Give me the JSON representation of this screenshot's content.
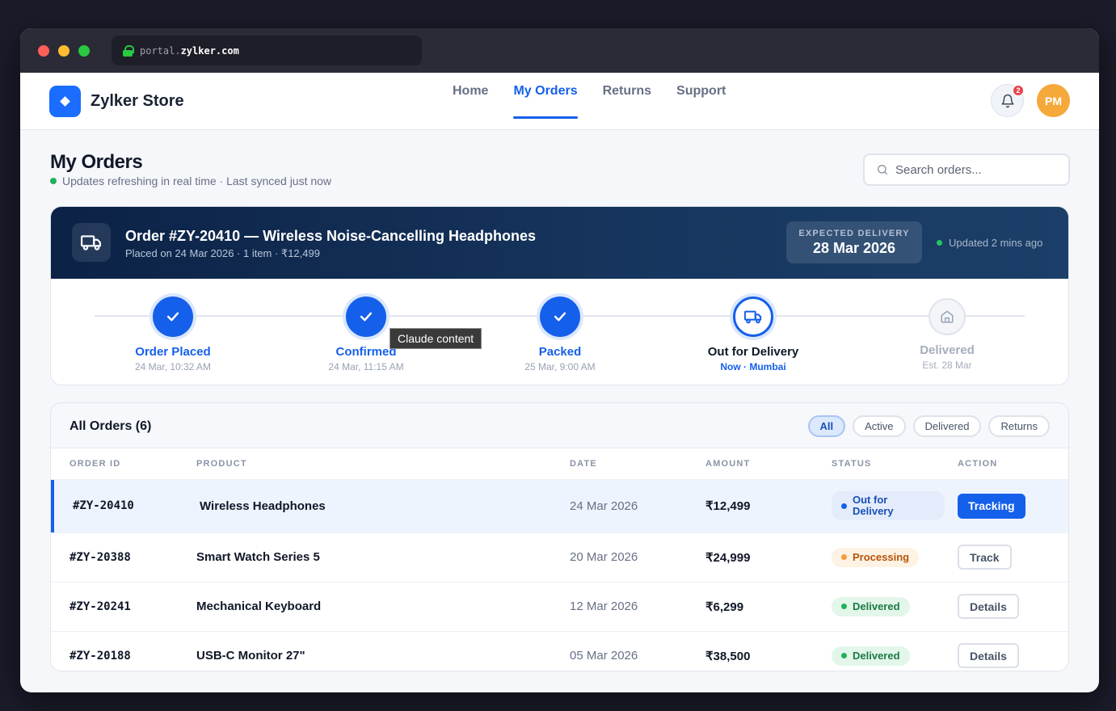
{
  "browser": {
    "url_prefix": "portal.",
    "url_domain": "zylker.com"
  },
  "nav": {
    "brand": "Zylker Store",
    "links": [
      "Home",
      "My Orders",
      "Returns",
      "Support"
    ],
    "active_link": "My Orders",
    "notification_count": "2",
    "avatar_initials": "PM"
  },
  "page": {
    "title": "My Orders",
    "live_status": "Updates refreshing in real time · Last synced just now",
    "search_placeholder": "Search orders..."
  },
  "tracking": {
    "order_title": "Order #ZY-20410 — Wireless Noise-Cancelling Headphones",
    "order_sub": "Placed on 24 Mar 2026 · 1 item · ₹12,499",
    "eta_label": "EXPECTED DELIVERY",
    "eta_date": "28 Mar 2026",
    "updated": "Updated 2 mins ago",
    "steps": [
      {
        "label": "Order Placed",
        "sub": "24 Mar, 10:32 AM",
        "state": "done",
        "icon": "check-icon"
      },
      {
        "label": "Confirmed",
        "sub": "24 Mar, 11:15 AM",
        "state": "done",
        "icon": "check-icon"
      },
      {
        "label": "Packed",
        "sub": "25 Mar, 9:00 AM",
        "state": "done",
        "icon": "check-icon"
      },
      {
        "label": "Out for Delivery",
        "sub": "Now · Mumbai",
        "state": "current",
        "icon": "truck-icon"
      },
      {
        "label": "Delivered",
        "sub": "Est. 28 Mar",
        "state": "pending",
        "icon": "home-icon"
      }
    ]
  },
  "tooltip": "Claude content",
  "orders": {
    "title": "All Orders (6)",
    "filters": [
      "All",
      "Active",
      "Delivered",
      "Returns"
    ],
    "active_filter": "All",
    "columns": [
      "ORDER ID",
      "PRODUCT",
      "DATE",
      "AMOUNT",
      "STATUS",
      "ACTION"
    ],
    "rows": [
      {
        "id": "#ZY-20410",
        "product": "Wireless Headphones",
        "date": "24 Mar 2026",
        "amount": "₹12,499",
        "status_line1": "Out for",
        "status_line2": "Delivery",
        "status": "Out for Delivery",
        "status_type": "transit",
        "action": "Tracking",
        "selected": true
      },
      {
        "id": "#ZY-20388",
        "product": "Smart Watch Series 5",
        "date": "20 Mar 2026",
        "amount": "₹24,999",
        "status": "Processing",
        "status_type": "processing",
        "action": "Track"
      },
      {
        "id": "#ZY-20241",
        "product": "Mechanical Keyboard",
        "date": "12 Mar 2026",
        "amount": "₹6,299",
        "status": "Delivered",
        "status_type": "delivered",
        "action": "Details"
      },
      {
        "id": "#ZY-20188",
        "product": "USB-C Monitor 27\"",
        "date": "05 Mar 2026",
        "amount": "₹38,500",
        "status": "Delivered",
        "status_type": "delivered",
        "action": "Details"
      }
    ]
  },
  "colors": {
    "accent": "#1560ea",
    "header_dark": "#0c2246",
    "success": "#22b15a",
    "warning": "#f59b38"
  }
}
